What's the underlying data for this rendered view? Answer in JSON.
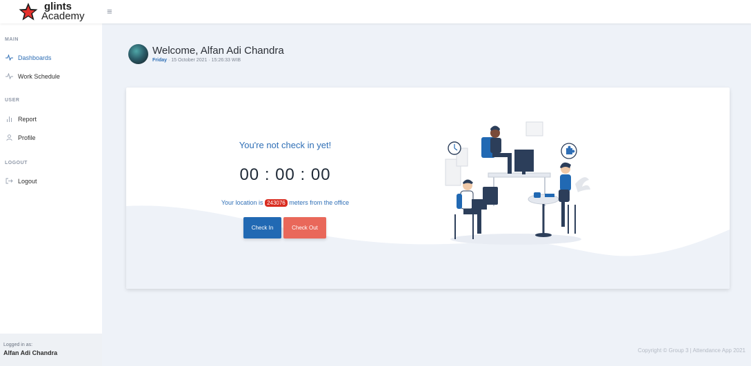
{
  "brand": {
    "line1": "glints",
    "line2": "Academy"
  },
  "topbar": {
    "menu_icon": "hamburger-icon"
  },
  "sidebar": {
    "sections": [
      {
        "title": "MAIN"
      },
      {
        "title": "USER"
      },
      {
        "title": "LOGOUT"
      }
    ],
    "items": [
      {
        "label": "Dashboards",
        "icon": "activity-icon",
        "active": true
      },
      {
        "label": "Work Schedule",
        "icon": "activity-icon",
        "active": false
      },
      {
        "label": "Report",
        "icon": "bar-chart-icon",
        "active": false
      },
      {
        "label": "Profile",
        "icon": "user-icon",
        "active": false
      },
      {
        "label": "Logout",
        "icon": "logout-icon",
        "active": false
      }
    ],
    "logged_in": {
      "label": "Logged in as:",
      "name": "Alfan Adi Chandra"
    }
  },
  "header": {
    "welcome": "Welcome, Alfan Adi Chandra",
    "day": "Friday",
    "datetime_rest": " · 15 October 2021 · 15:26:33 WIB"
  },
  "attendance": {
    "status": "You're not check in yet!",
    "timer": "00 : 00 : 00",
    "location_prefix": "Your location is ",
    "distance": "243076",
    "location_suffix": " meters from the office",
    "check_in_label": "Check In",
    "check_out_label": "Check Out"
  },
  "footer": {
    "copyright": "Copyright © Group 3 | Attendance App 2021"
  },
  "colors": {
    "accent": "#2f6fb6",
    "check_in": "#2169b3",
    "check_out": "#e9685a",
    "badge": "#d92c20",
    "background": "#eef2f8"
  }
}
